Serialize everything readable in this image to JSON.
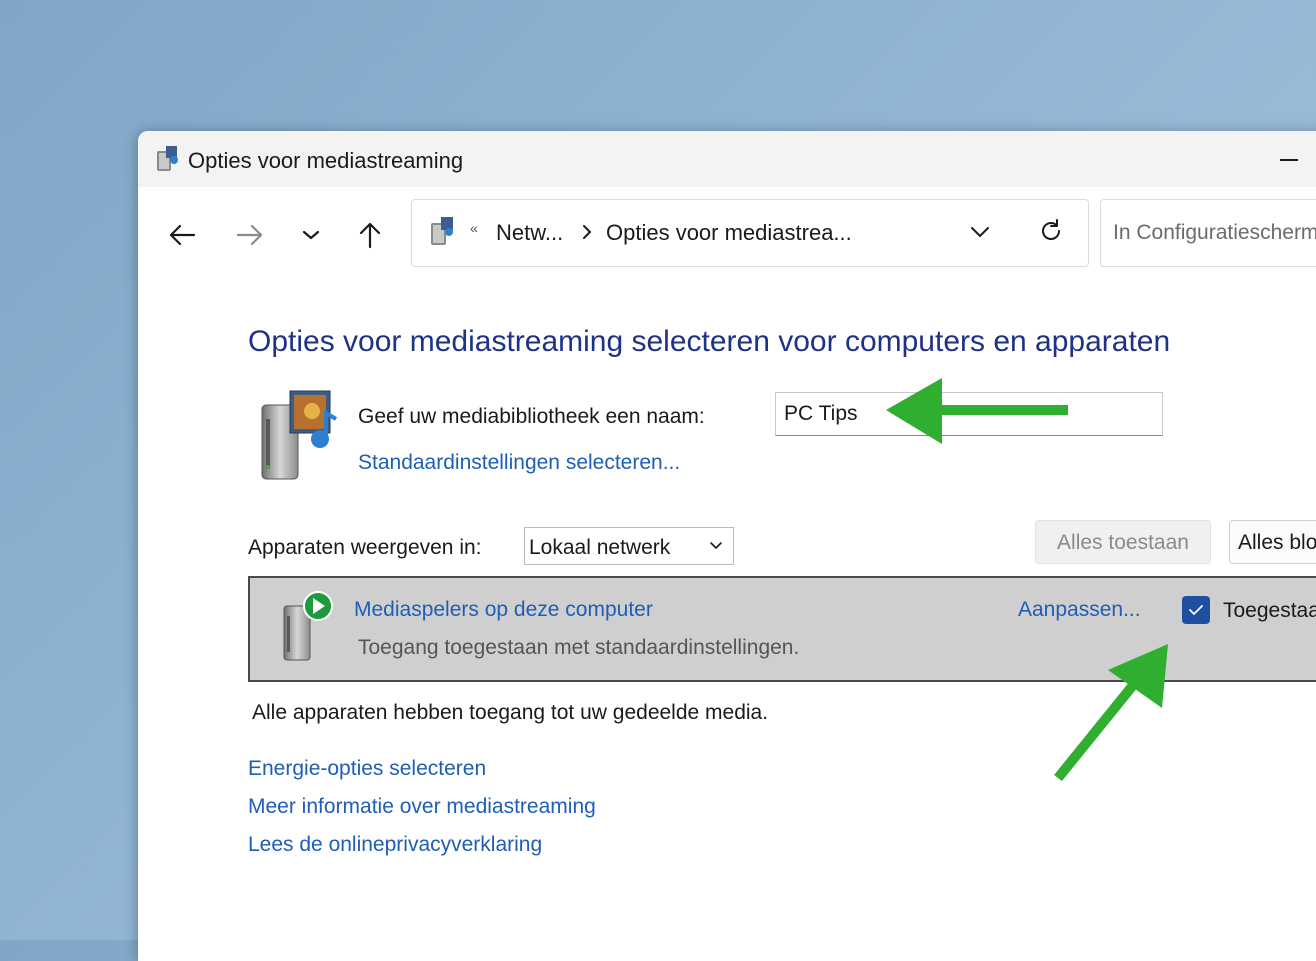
{
  "window": {
    "title": "Opties voor mediastreaming"
  },
  "navigation": {
    "breadcrumb_overflow": "«",
    "breadcrumb": [
      "Netw...",
      "Opties voor mediastrea..."
    ],
    "search_placeholder": "In Configuratiescherm zoeken"
  },
  "main": {
    "heading": "Opties voor mediastreaming selecteren voor computers en apparaten",
    "library_name_label": "Geef uw mediabibliotheek een naam:",
    "library_name_value": "PC Tips",
    "default_settings_link": "Standaardinstellingen selecteren...",
    "show_devices_label": "Apparaten weergeven in:",
    "show_devices_value": "Lokaal netwerk",
    "allow_all_button": "Alles toestaan",
    "block_all_button": "Alles blokkeren"
  },
  "devices": [
    {
      "name": "Mediaspelers op deze computer",
      "status": "Toegang toegestaan met standaardinstellingen.",
      "customize_link": "Aanpassen...",
      "allowed_label": "Toegestaan",
      "allowed": true
    }
  ],
  "footer": {
    "all_devices_text": "Alle apparaten hebben toegang tot uw gedeelde media.",
    "links": [
      "Energie-opties selecteren",
      "Meer informatie over mediastreaming",
      "Lees de onlineprivacyverklaring"
    ]
  },
  "colors": {
    "heading": "#1e3287",
    "link": "#1f5eb8",
    "checkbox": "#1e4fa0",
    "annotation_arrow": "#2fae2f"
  }
}
